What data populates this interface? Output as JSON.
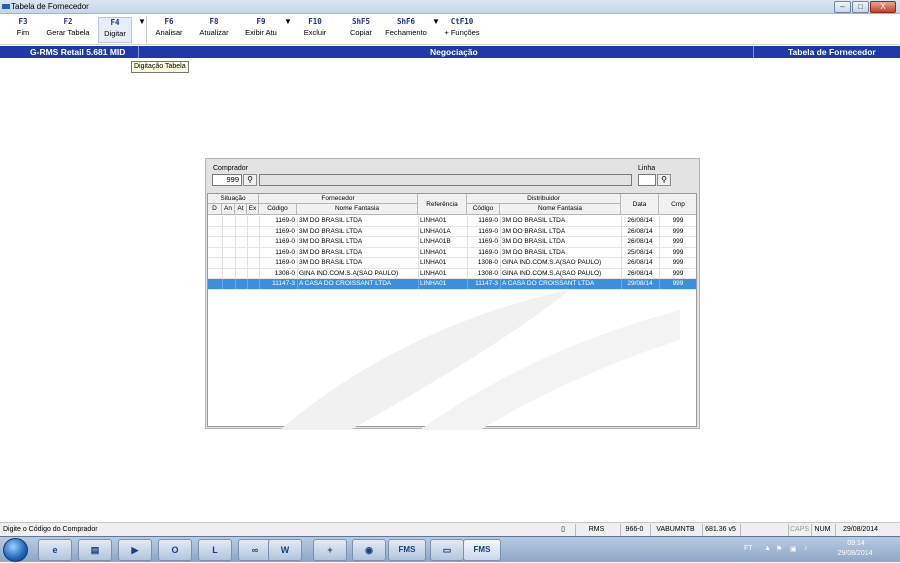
{
  "window": {
    "title": "Tabela de Fornecedor",
    "min": "–",
    "max": "□",
    "close": "X"
  },
  "toolbar": [
    {
      "key": "F3",
      "label": "Fim"
    },
    {
      "key": "F2",
      "label": "Gerar Tabela"
    },
    {
      "key": "F4",
      "label": "Digitar"
    },
    {
      "key": "F6",
      "label": "Analisar"
    },
    {
      "key": "F8",
      "label": "Atualizar"
    },
    {
      "key": "F9",
      "label": "Exibir Atu"
    },
    {
      "key": "F10",
      "label": "Excluir"
    },
    {
      "key": "ShF5",
      "label": "Copiar"
    },
    {
      "key": "ShF6",
      "label": "Fechamento"
    },
    {
      "key": "CtF10",
      "label": "+ Funções"
    }
  ],
  "nav": {
    "left": "G-RMS Retail 5.681 MID",
    "center": "Negociação",
    "right": "Tabela de Fornecedor"
  },
  "tooltip": "Digitação Tabela",
  "form": {
    "comprador_label": "Comprador",
    "comprador_value": "999",
    "linha_label": "Linha",
    "linha_value": ""
  },
  "grid": {
    "groups": {
      "situacao": "Situação",
      "fornecedor": "Fornecedor",
      "referencia": "Referência",
      "distribuidor": "Distribuidor",
      "data": "Data",
      "cmp": "Cmp"
    },
    "sub": {
      "d": "D",
      "an": "An",
      "at": "At",
      "ex": "Ex",
      "codigo": "Código",
      "nome": "Nome Fantasia",
      "dcodigo": "Código",
      "dnome": "Nome Fantasia"
    },
    "rows": [
      {
        "fc": "1169-0",
        "fn": "3M DO BRASIL LTDA",
        "ref": "LINHA01",
        "dc": "1169-0",
        "dn": "3M DO BRASIL LTDA",
        "data": "26/08/14",
        "cmp": "999"
      },
      {
        "fc": "1169-0",
        "fn": "3M DO BRASIL LTDA",
        "ref": "LINHA01A",
        "dc": "1169-0",
        "dn": "3M DO BRASIL LTDA",
        "data": "26/08/14",
        "cmp": "999"
      },
      {
        "fc": "1169-0",
        "fn": "3M DO BRASIL LTDA",
        "ref": "LINHA01B",
        "dc": "1169-0",
        "dn": "3M DO BRASIL LTDA",
        "data": "26/08/14",
        "cmp": "999"
      },
      {
        "fc": "1169-0",
        "fn": "3M DO BRASIL LTDA",
        "ref": "LINHA01",
        "dc": "1169-0",
        "dn": "3M DO BRASIL LTDA",
        "data": "25/08/14",
        "cmp": "999"
      },
      {
        "fc": "1169-0",
        "fn": "3M DO BRASIL LTDA",
        "ref": "LINHA01",
        "dc": "1308-0",
        "dn": "GINA IND.COM.S.A(SAO PAULO)",
        "data": "26/08/14",
        "cmp": "999"
      },
      {
        "fc": "1308-0",
        "fn": "GINA IND.COM.S.A(SAO PAULO)",
        "ref": "LINHA01",
        "dc": "1308-0",
        "dn": "GINA IND.COM.S.A(SAO PAULO)",
        "data": "26/08/14",
        "cmp": "999"
      },
      {
        "fc": "11147-3",
        "fn": "A CASA DO CROISSANT LTDA",
        "ref": "LINHA01",
        "dc": "11147-3",
        "dn": "A CASA DO CROISSANT LTDA",
        "data": "29/08/14",
        "cmp": "999",
        "selected": true
      }
    ]
  },
  "status": {
    "message": "Digite o Código do Comprador",
    "s1": "RMS",
    "s2": "966-0",
    "s3": "VABUMNTB",
    "s4": "681.36 v5",
    "caps": "CAPS",
    "num": "NUM",
    "date": "29/08/2014"
  },
  "taskbar": {
    "ft": "FT",
    "time": "09:14",
    "date": "29/08/2014",
    "fms1": "FMS",
    "fms2": "FMS"
  },
  "colors": {
    "nav": "#1f3aa8",
    "selection": "#3d8fdc",
    "key": "#1f2f8a"
  }
}
